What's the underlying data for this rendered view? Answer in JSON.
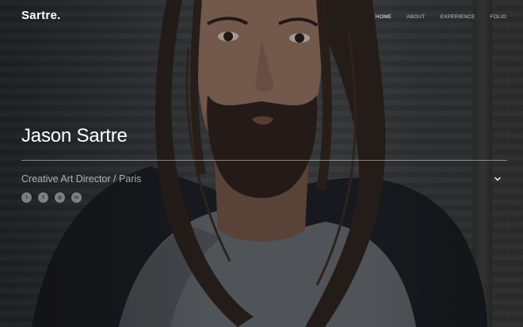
{
  "site": {
    "logo": "Sartre."
  },
  "nav": {
    "items": [
      {
        "label": "HOME",
        "active": true
      },
      {
        "label": "ABOUT"
      },
      {
        "label": "EXPERIENCE"
      },
      {
        "label": "FOLIO"
      }
    ]
  },
  "intro": {
    "name": "Jason Sartre",
    "subtitle": "Creative Art Director / Paris",
    "scroll_icon": "chevron-down-icon"
  },
  "social": [
    {
      "icon": "twitter-icon",
      "glyph": "t"
    },
    {
      "icon": "facebook-icon",
      "glyph": "f"
    },
    {
      "icon": "instagram-icon",
      "glyph": "◎"
    },
    {
      "icon": "linkedin-icon",
      "glyph": "in"
    }
  ],
  "colors": {
    "text": "#ffffff",
    "overlay": "#0c0e12"
  }
}
